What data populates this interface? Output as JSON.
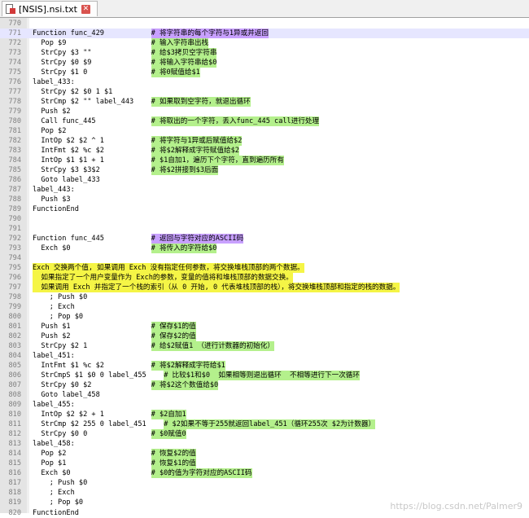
{
  "tab": {
    "title": "[NSIS].nsi.txt",
    "close_glyph": "✕"
  },
  "watermark": "https://blog.csdn.net/Palmer9",
  "colors": {
    "comment_green": "#b4f08c",
    "comment_purple": "#c8a0ff",
    "comment_yellow": "#f5f546",
    "gutter": "#e4e4e4",
    "current_line": "#e6e6ff"
  },
  "lines": [
    {
      "n": "770",
      "code": ""
    },
    {
      "n": "771",
      "code": "Function func_429",
      "comment": "# 将字符串的每个字符与1异或并返回",
      "hl": "purple",
      "current": true
    },
    {
      "n": "772",
      "code": "  Pop $9",
      "comment": "# 输入字符串出栈",
      "hl": "green"
    },
    {
      "n": "773",
      "code": "  StrCpy $3 \"\"",
      "comment": "# 给$3拷贝空字符串",
      "hl": "green"
    },
    {
      "n": "774",
      "code": "  StrCpy $0 $9",
      "comment": "# 将输入字符串给$0",
      "hl": "green"
    },
    {
      "n": "775",
      "code": "  StrCpy $1 0",
      "comment": "# 将0赋值给$1",
      "hl": "green"
    },
    {
      "n": "776",
      "code": "label_433:"
    },
    {
      "n": "777",
      "code": "  StrCpy $2 $0 1 $1"
    },
    {
      "n": "778",
      "code": "  StrCmp $2 \"\" label_443",
      "comment": "# 如果取到空字符，就退出循环",
      "hl": "green"
    },
    {
      "n": "779",
      "code": "  Push $2"
    },
    {
      "n": "780",
      "code": "  Call func_445",
      "comment": "# 将取出的一个字符，丢入func_445 call进行处理",
      "hl": "green"
    },
    {
      "n": "781",
      "code": "  Pop $2"
    },
    {
      "n": "782",
      "code": "  IntOp $2 $2 ^ 1",
      "comment": "# 将字符与1异或后赋值给$2",
      "hl": "green"
    },
    {
      "n": "783",
      "code": "  IntFmt $2 %c $2",
      "comment": "# 将$2解释成字符赋值给$2",
      "hl": "green"
    },
    {
      "n": "784",
      "code": "  IntOp $1 $1 + 1",
      "comment": "# $1自加1，遍历下个字符，直到遍历所有",
      "hl": "green"
    },
    {
      "n": "785",
      "code": "  StrCpy $3 $3$2",
      "comment": "# 将$2拼接到$3后面",
      "hl": "green"
    },
    {
      "n": "786",
      "code": "  Goto label_433"
    },
    {
      "n": "787",
      "code": "label_443:"
    },
    {
      "n": "788",
      "code": "  Push $3"
    },
    {
      "n": "789",
      "code": "FunctionEnd"
    },
    {
      "n": "790",
      "code": ""
    },
    {
      "n": "791",
      "code": ""
    },
    {
      "n": "792",
      "code": "Function func_445",
      "comment": "# 返回与字符对应的ASCII码",
      "hl": "purple"
    },
    {
      "n": "793",
      "code": "  Exch $0",
      "comment": "# 将传入的字符给$0",
      "hl": "green"
    },
    {
      "n": "794",
      "code": ""
    },
    {
      "n": "795",
      "code": "",
      "comment": "Exch 交换两个值, 如果调用 Exch 没有指定任何参数，将交换堆栈顶部的两个数据。",
      "hl": "yellow",
      "cm_col": 0
    },
    {
      "n": "796",
      "code": "",
      "comment": "  如果指定了一个用户变量作为 Exch的参数，变量的值将和堆栈顶部的数据交换。",
      "hl": "yellow",
      "cm_col": 0
    },
    {
      "n": "797",
      "code": "",
      "comment": "  如果调用 Exch 并指定了一个栈的索引（从 0 开始, 0 代表堆栈顶部的栈），将交换堆栈顶部和指定的栈的数据。",
      "hl": "yellow",
      "cm_col": 0
    },
    {
      "n": "798",
      "code": "    ; Push $0"
    },
    {
      "n": "799",
      "code": "    ; Exch"
    },
    {
      "n": "800",
      "code": "    ; Pop $0"
    },
    {
      "n": "801",
      "code": "  Push $1",
      "comment": "# 保存$1的值",
      "hl": "green"
    },
    {
      "n": "802",
      "code": "  Push $2",
      "comment": "# 保存$2的值",
      "hl": "green"
    },
    {
      "n": "803",
      "code": "  StrCpy $2 1",
      "comment": "# 给$2赋值1 （进行计数器的初始化）",
      "hl": "green"
    },
    {
      "n": "804",
      "code": "label_451:"
    },
    {
      "n": "805",
      "code": "  IntFmt $1 %c $2",
      "comment": "# 将$2解释成字符给$1",
      "hl": "green"
    },
    {
      "n": "806",
      "code": "  StrCmpS $1 $0 0 label_455",
      "comment": "# 比较$1和$0  如果相等则退出循环  不相等进行下一次循环",
      "hl": "green",
      "cm_col": 31
    },
    {
      "n": "807",
      "code": "  StrCpy $0 $2",
      "comment": "# 将$2这个数值给$0",
      "hl": "green"
    },
    {
      "n": "808",
      "code": "  Goto label_458"
    },
    {
      "n": "809",
      "code": "label_455:"
    },
    {
      "n": "810",
      "code": "  IntOp $2 $2 + 1",
      "comment": "# $2自加1",
      "hl": "green"
    },
    {
      "n": "811",
      "code": "  StrCmp $2 255 0 label_451",
      "comment": "# $2如果不等于255就返回label_451（循环255次 $2为计数器）",
      "hl": "green",
      "cm_col": 31
    },
    {
      "n": "812",
      "code": "  StrCpy $0 0",
      "comment": "# $0赋值0",
      "hl": "green"
    },
    {
      "n": "813",
      "code": "label_458:"
    },
    {
      "n": "814",
      "code": "  Pop $2",
      "comment": "# 恢复$2的值",
      "hl": "green"
    },
    {
      "n": "815",
      "code": "  Pop $1",
      "comment": "# 恢复$1的值",
      "hl": "green"
    },
    {
      "n": "816",
      "code": "  Exch $0",
      "comment": "# $0的值为字符对应的ASCII码",
      "hl": "green"
    },
    {
      "n": "817",
      "code": "    ; Push $0"
    },
    {
      "n": "818",
      "code": "    ; Exch"
    },
    {
      "n": "819",
      "code": "    ; Pop $0"
    },
    {
      "n": "820",
      "code": "FunctionEnd"
    }
  ]
}
